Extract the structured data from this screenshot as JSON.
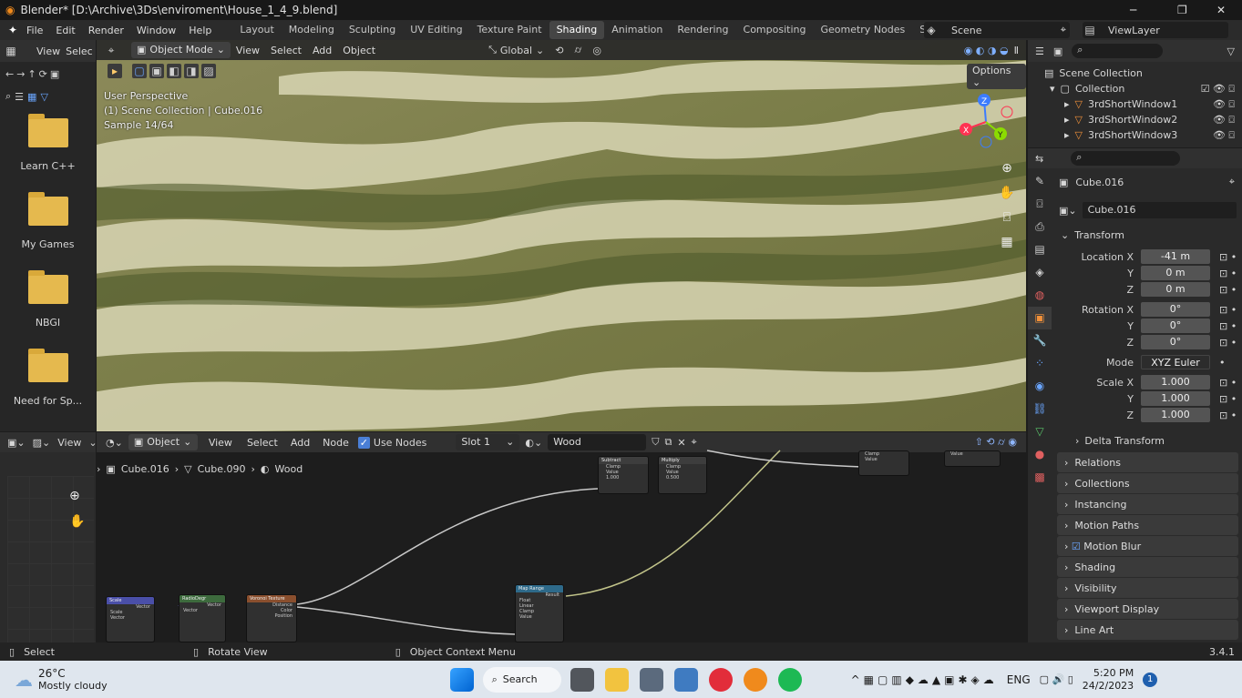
{
  "window": {
    "title": "Blender* [D:\\Archive\\3Ds\\enviroment\\House_1_4_9.blend]",
    "minimize": "─",
    "maximize": "❐",
    "close": "✕"
  },
  "menu": [
    "File",
    "Edit",
    "Render",
    "Window",
    "Help"
  ],
  "workspaces": [
    "Layout",
    "Modeling",
    "Sculpting",
    "UV Editing",
    "Texture Paint",
    "Shading",
    "Animation",
    "Rendering",
    "Compositing",
    "Geometry Nodes",
    "Scripting"
  ],
  "active_workspace": "Shading",
  "scene": {
    "name": "Scene",
    "view_layer": "ViewLayer"
  },
  "file_browser": {
    "view": "View",
    "select": "Selec",
    "folders": [
      "Learn C++",
      "My Games",
      "NBGI",
      "Need for Sp..."
    ]
  },
  "viewport": {
    "mode": "Object Mode",
    "menus": [
      "View",
      "Select",
      "Add",
      "Object"
    ],
    "transform_orientation": "Global",
    "options": "Options",
    "overlay_lines": [
      "User Perspective",
      "(1) Scene Collection | Cube.016",
      "Sample 14/64"
    ],
    "gizmo": {
      "x": "X",
      "y": "Y",
      "z": "Z"
    }
  },
  "outliner": {
    "root": "Scene Collection",
    "collection": "Collection",
    "items": [
      "3rdShortWindow1",
      "3rdShortWindow2",
      "3rdShortWindow3"
    ]
  },
  "properties": {
    "object_name": "Cube.016",
    "data_name": "Cube.016",
    "transform_title": "Transform",
    "location": [
      {
        "label": "Location X",
        "value": "-41 m"
      },
      {
        "label": "Y",
        "value": "0 m"
      },
      {
        "label": "Z",
        "value": "0 m"
      }
    ],
    "rotation": [
      {
        "label": "Rotation X",
        "value": "0°"
      },
      {
        "label": "Y",
        "value": "0°"
      },
      {
        "label": "Z",
        "value": "0°"
      }
    ],
    "mode": {
      "label": "Mode",
      "value": "XYZ Euler"
    },
    "scale": [
      {
        "label": "Scale X",
        "value": "1.000"
      },
      {
        "label": "Y",
        "value": "1.000"
      },
      {
        "label": "Z",
        "value": "1.000"
      }
    ],
    "delta": "Delta Transform",
    "sections": [
      "Relations",
      "Collections",
      "Instancing",
      "Motion Paths",
      "Motion Blur",
      "Shading",
      "Visibility",
      "Viewport Display",
      "Line Art"
    ]
  },
  "node_editor": {
    "view": "View",
    "object": "Object",
    "menus": [
      "View",
      "Select",
      "Add",
      "Node"
    ],
    "use_nodes": "Use Nodes",
    "slot": "Slot 1",
    "material": "Wood",
    "breadcrumb": [
      "Cube.016",
      "Cube.090",
      "Wood"
    ],
    "nodes": {
      "scale": "Scale",
      "radial": "RadioDegr",
      "voronoi": "Voronoi Texture",
      "map_range": "Map Range",
      "subtract": "Subtract",
      "multiply": "Multiply",
      "clamp": "Clamp",
      "value": "Value",
      "vector": "Vector",
      "distance": "Distance",
      "color": "Color",
      "position": "Position",
      "result": "Result",
      "float": "Float",
      "linear": "Linear",
      "v1": "1.000",
      "v2": "0.500"
    }
  },
  "statusbar": {
    "select": "Select",
    "rotate": "Rotate View",
    "context": "Object Context Menu",
    "version": "3.4.1"
  },
  "taskbar": {
    "weather_temp": "26°C",
    "weather_desc": "Mostly cloudy",
    "search": "Search",
    "lang": "ENG",
    "time": "5:20 PM",
    "date": "24/2/2023",
    "notif": "1"
  }
}
